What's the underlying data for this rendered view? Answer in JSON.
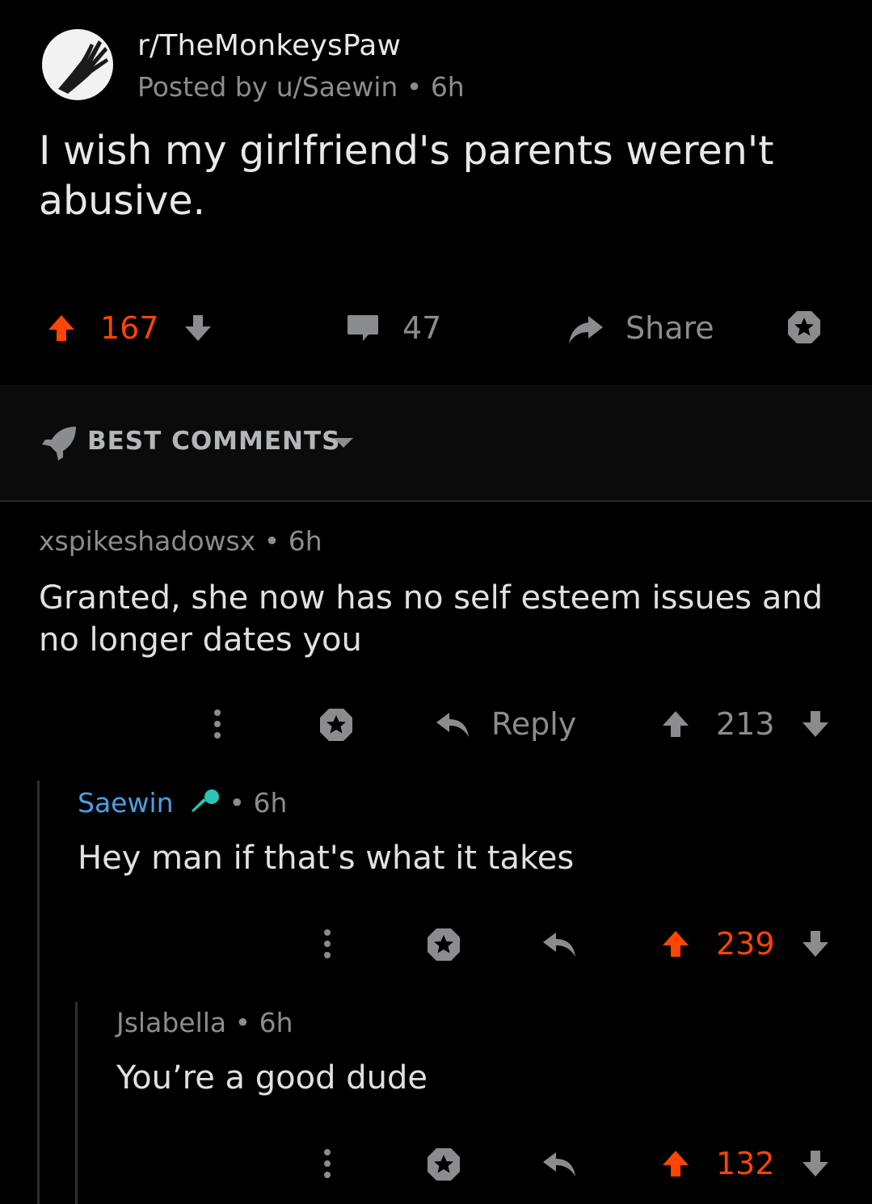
{
  "post": {
    "subreddit": "r/TheMonkeysPaw",
    "posted_by": "Posted by u/Saewin",
    "age": "6h",
    "title": "I wish my girlfriend's parents weren't abusive.",
    "upvotes": "167",
    "comments": "47",
    "share_label": "Share"
  },
  "sort": {
    "label": "BEST COMMENTS"
  },
  "comments": [
    {
      "author": "xspikeshadowsx",
      "age": "6h",
      "body": "Granted, she now has no self esteem issues and no longer dates you",
      "reply_label": "Reply",
      "score": "213"
    },
    {
      "author": "Saewin",
      "age": "6h",
      "body": "Hey man if that's what it takes",
      "score": "239"
    },
    {
      "author": "Jslabella",
      "age": "6h",
      "body": "You’re a good dude",
      "score": "132"
    }
  ],
  "colors": {
    "background": "#000000",
    "upvote_orange": "#ff4500",
    "op_blue": "#4a9fe3",
    "mic_teal": "#2bc4b5",
    "muted_grey": "#8a8c8e"
  }
}
